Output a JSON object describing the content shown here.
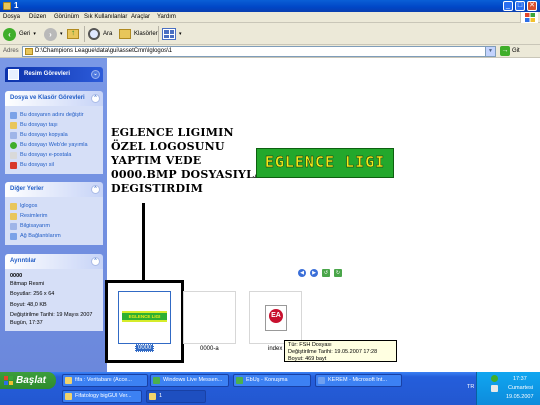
{
  "window": {
    "title": "1"
  },
  "menu": [
    "Dosya",
    "Düzen",
    "Görünüm",
    "Sık Kullanılanlar",
    "Araçlar",
    "Yardım"
  ],
  "toolbar": {
    "back": "Geri",
    "search": "Ara",
    "folders": "Klasörler"
  },
  "address": {
    "label": "Adres",
    "path": "D:\\Champions League\\data\\gui\\assetCmn\\lglogos\\1",
    "go": "Git"
  },
  "panes": {
    "resim": {
      "title": "Resim Görevleri"
    },
    "tasks": {
      "title": "Dosya ve Klasör Görevleri",
      "items": [
        "Bu dosyanın adını değiştir",
        "Bu dosyayı taşı",
        "Bu dosyayı kopyala",
        "Bu dosyayı Web'de yayımla",
        "Bu dosyayı e-postala",
        "Bu dosyayı sil"
      ]
    },
    "places": {
      "title": "Diğer Yerler",
      "items": [
        "lglogos",
        "Resimlerim",
        "Bilgisayarım",
        "Ağ Bağlantılarım"
      ]
    },
    "details": {
      "title": "Ayrıntılar",
      "name": "0000",
      "type": "Bitmap Resmi",
      "dims": "Boyutlar: 256 x 64",
      "size": "Boyut: 48,0 KB",
      "modified": "Değiştirilme Tarihi: 19 Mayıs 2007 Bugün, 17:37"
    }
  },
  "annotation": {
    "text": "EGLENCE LIGIMIN\nÖZEL LOGOSUNU\nYAPTIM VEDE\n0000.BMP DOSYASIYLA\nDEGISTIRDIM"
  },
  "preview": {
    "text": "EGLENCE LIGI"
  },
  "files": [
    {
      "name": "0000",
      "banner": "EGLENCE LIGI"
    },
    {
      "name": "0000-a"
    },
    {
      "name": "index",
      "icon": "EA"
    }
  ],
  "tooltip": {
    "type": "Tür: FSH Dosyası",
    "modified": "Değiştirilme Tarihi: 19.05.2007 17:28",
    "size": "Boyut: 469 bayt"
  },
  "taskbar": {
    "start": "Başlat",
    "items": [
      "fifa : Veritabanı (Acce...",
      "Windows Live Messen...",
      "EbUş - Konuşma",
      "KEREM - Microsoft Int...",
      "Fifatology bigGUI Ver...",
      "1"
    ],
    "lang": "TR",
    "time": "17:37",
    "day": "Cumartesi",
    "date": "19.05.2007"
  },
  "colors": {
    "title_blue": "#0046c6",
    "pane_blue": "#6b88dc",
    "start_green": "#2e8b2e",
    "tray_blue": "#0d8bdc"
  }
}
